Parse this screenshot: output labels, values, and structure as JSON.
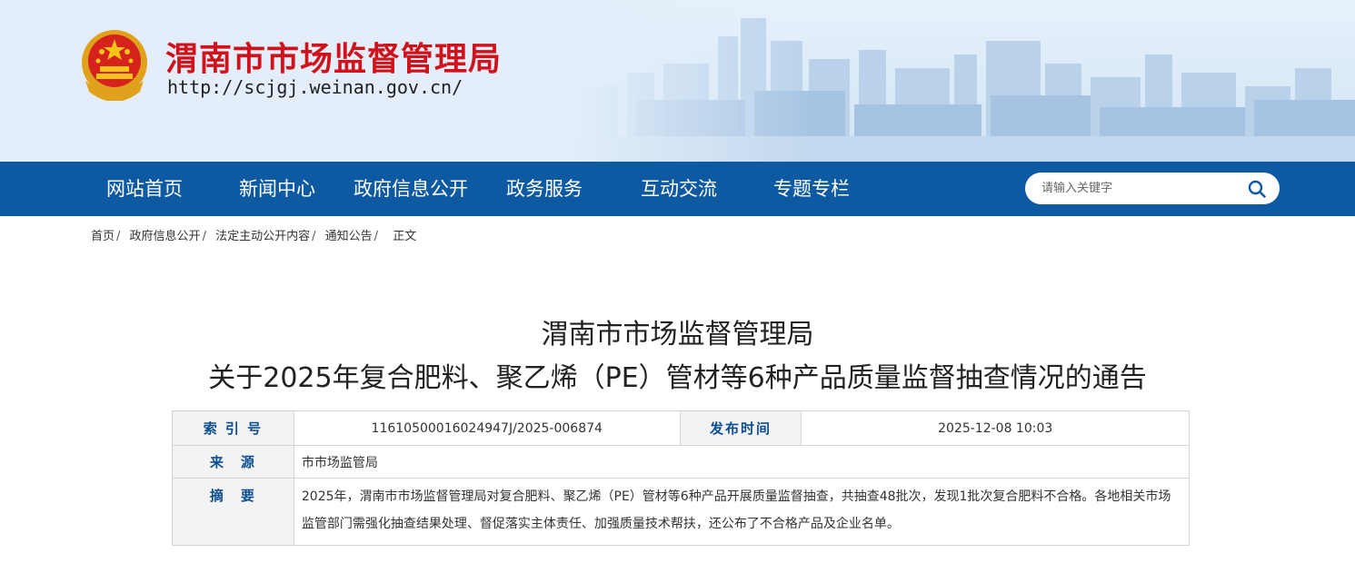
{
  "header": {
    "title": "渭南市市场监督管理局",
    "url": "http://scjgj.weinan.gov.cn/"
  },
  "nav": {
    "items": [
      {
        "label": "网站首页"
      },
      {
        "label": "新闻中心"
      },
      {
        "label": "政府信息公开"
      },
      {
        "label": "政务服务"
      },
      {
        "label": "互动交流"
      },
      {
        "label": "专题专栏"
      }
    ]
  },
  "search": {
    "placeholder": "请输入关键字",
    "icon": "search-icon"
  },
  "breadcrumb": {
    "items": [
      "首页",
      "政府信息公开",
      "法定主动公开内容",
      "通知公告"
    ],
    "separator": "/",
    "current": "正文"
  },
  "article": {
    "title_line1": "渭南市市场监督管理局",
    "title_line2": "关于2025年复合肥料、聚乙烯（PE）管材等6种产品质量监督抽查情况的通告"
  },
  "meta": {
    "index_label": "索 引 号",
    "index_value": "11610500016024947J/2025-006874",
    "date_label": "发布时间",
    "date_value": "2025-12-08 10:03",
    "source_label": "来　源",
    "source_value": "市市场监管局",
    "summary_label": "摘　要",
    "summary_value": "2025年，渭南市市场监督管理局对复合肥料、聚乙烯（PE）管材等6种产品开展质量监督抽查，共抽查48批次，发现1批次复合肥料不合格。各地相关市场监管部门需强化抽查结果处理、督促落实主体责任、加强质量技术帮扶，还公布了不合格产品及企业名单。"
  },
  "colors": {
    "title_red": "#d0121b",
    "nav_blue": "#0d5aa3",
    "label_blue": "#0d4e91"
  }
}
